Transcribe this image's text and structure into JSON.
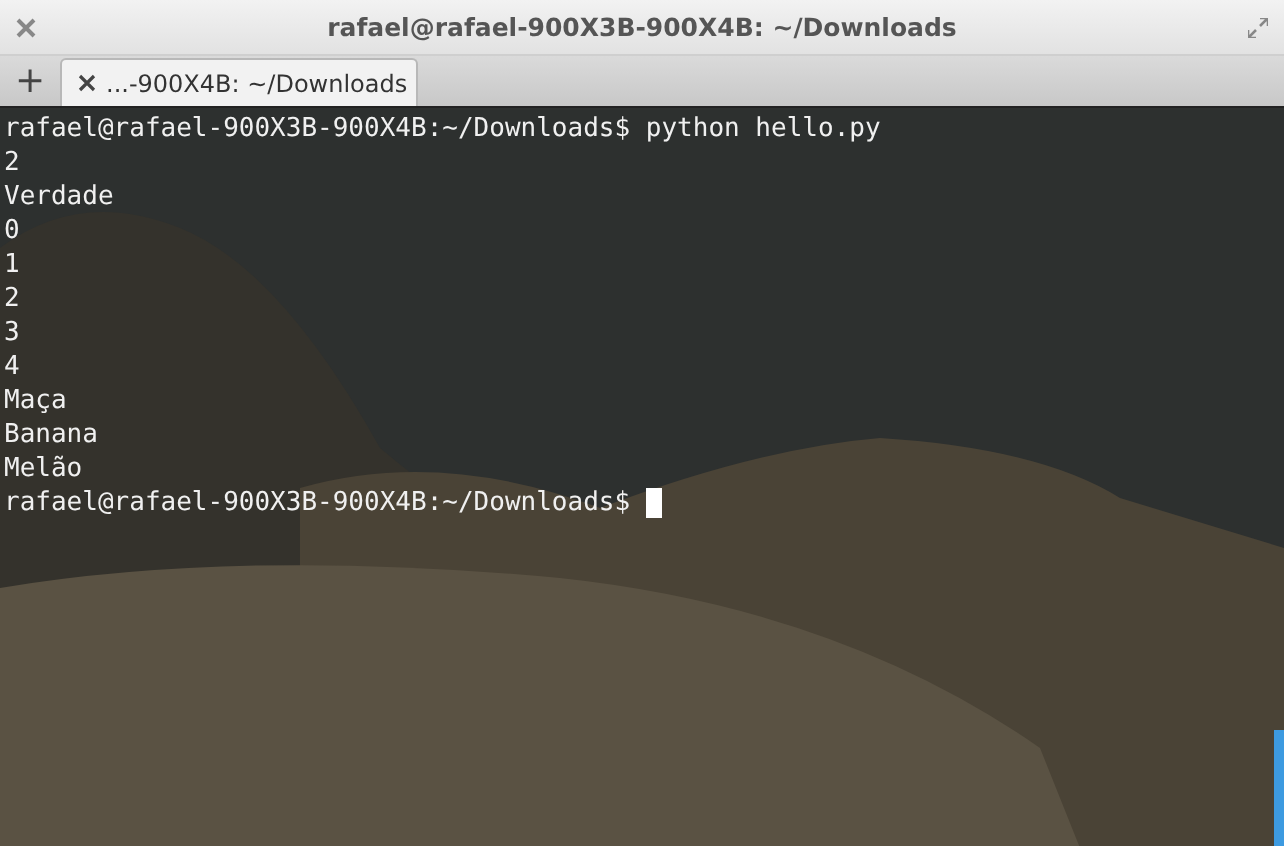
{
  "window": {
    "title": "rafael@rafael-900X3B-900X4B: ~/Downloads"
  },
  "new_tab_button": "+",
  "tabs": [
    {
      "label": "...-900X4B: ~/Downloads",
      "selected": true
    }
  ],
  "terminal": {
    "lines": [
      "rafael@rafael-900X3B-900X4B:~/Downloads$ python hello.py",
      "2",
      "Verdade",
      "0",
      "1",
      "2",
      "3",
      "4",
      "Maça",
      "Banana",
      "Melão"
    ],
    "prompt": "rafael@rafael-900X3B-900X4B:~/Downloads$"
  }
}
